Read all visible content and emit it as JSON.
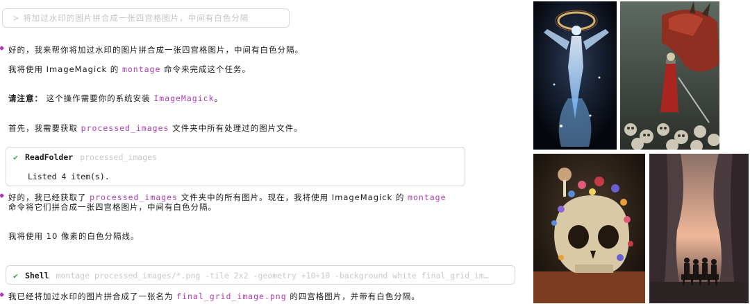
{
  "prompt": "> 将加过水印的图片拼合成一张四宫格图片，中间有白色分隔",
  "messages": {
    "m1": "好的，我来帮你将加过水印的图片拼合成一张四宫格图片，中间有白色分隔。",
    "m2_a": "我将使用 ImageMagick 的 ",
    "m2_b": "montage",
    "m2_c": " 命令来完成这个任务。",
    "m3_a": "请注意：",
    "m3_b": " 这个操作需要你的系统安装 ",
    "m3_c": "ImageMagick",
    "m3_d": "。",
    "m4_a": "首先，我需要获取 ",
    "m4_b": "processed_images",
    "m4_c": " 文件夹中所有处理过的图片文件。",
    "m5_a": "好的，我已经获取了 ",
    "m5_b": "processed_images",
    "m5_c": " 文件夹中的所有图片。现在，我将使用 ImageMagick 的 ",
    "m5_d": "montage",
    "m5_e": "命令将它们拼合成一张四宫格图片，中间有白色分隔。",
    "m6": "我将使用 10 像素的白色分隔线。",
    "m7_a": "我已经将加过水印的图片拼合成了一张名为 ",
    "m7_b": "final_grid_image.png",
    "m7_c": " 的四宫格图片，并带有白色分隔。"
  },
  "tools": {
    "read_folder": {
      "check": "✔",
      "name": "ReadFolder",
      "arg": "processed_images",
      "result": "Listed 4 item(s)."
    },
    "shell": {
      "check": "✔",
      "name": "Shell",
      "arg": "montage processed_images/*.png -tile 2x2 -geometry +10+10 -background white final_grid_im…"
    }
  },
  "colors": {
    "accent": "#b03bb0",
    "success": "#2fa84f",
    "muted": "#c9c9c9"
  }
}
